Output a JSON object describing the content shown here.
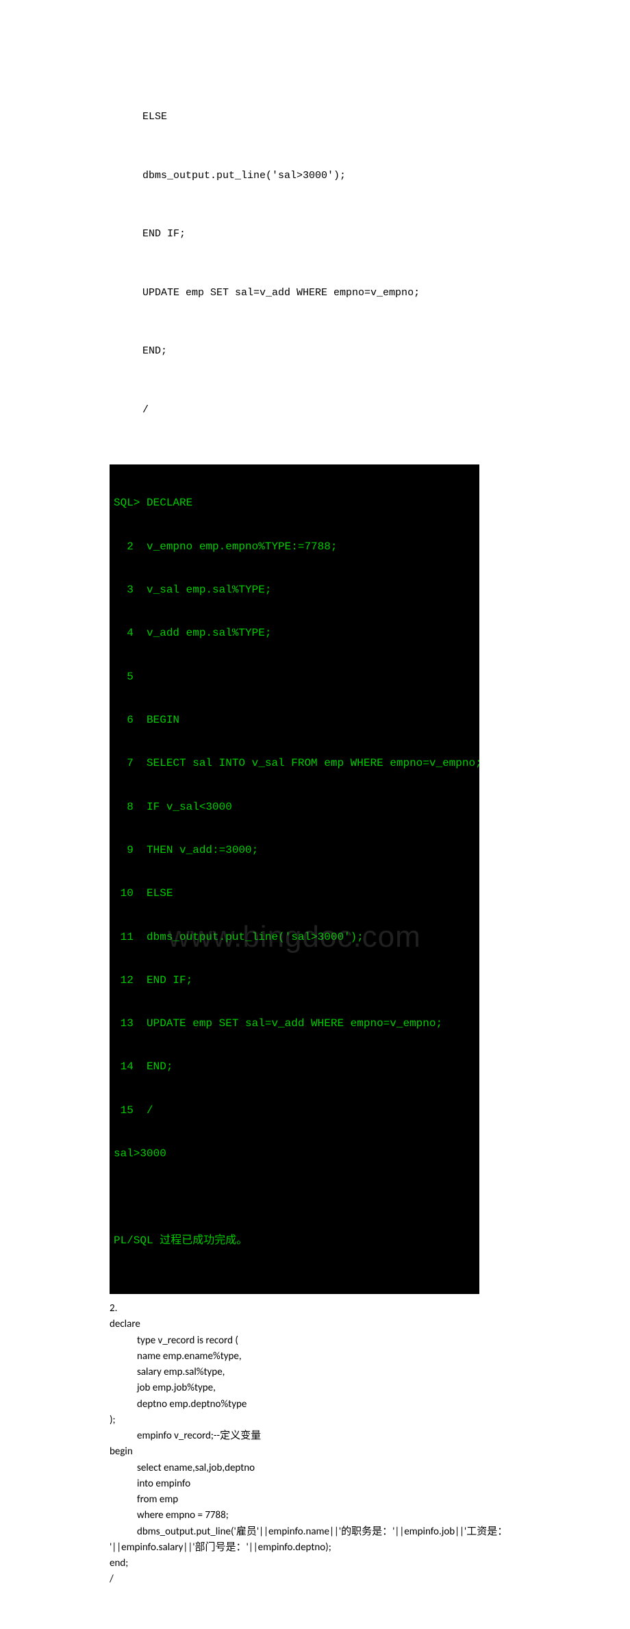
{
  "code1": {
    "l1": "ELSE",
    "l2": "dbms_output.put_line('sal>3000');",
    "l3": "END IF;",
    "l4": "UPDATE emp SET sal=v_add WHERE empno=v_empno;",
    "l5": "END;",
    "l6": "/"
  },
  "terminal": {
    "l1": "SQL> DECLARE",
    "l2": "  2  v_empno emp.empno%TYPE:=7788;",
    "l3": "  3  v_sal emp.sal%TYPE;",
    "l4": "  4  v_add emp.sal%TYPE;",
    "l5": "  5",
    "l6": "  6  BEGIN",
    "l7": "  7  SELECT sal INTO v_sal FROM emp WHERE empno=v_empno;",
    "l8": "  8  IF v_sal<3000",
    "l9": "  9  THEN v_add:=3000;",
    "l10": " 10  ELSE",
    "l11": " 11  dbms_output.put_line('sal>3000');",
    "l12": " 12  END IF;",
    "l13": " 13  UPDATE emp SET sal=v_add WHERE empno=v_empno;",
    "l14": " 14  END;",
    "l15": " 15  /",
    "l16": "sal>3000",
    "l17": " ",
    "l18": "PL/SQL 过程已成功完成。"
  },
  "watermark": "www.bingdoc.com",
  "section2": {
    "num": "2.",
    "l1": "declare",
    "l2": "type v_record is record (",
    "l3": "name emp.ename%type,",
    "l4": "salary emp.sal%type,",
    "l5": "job emp.job%type,",
    "l6": "deptno emp.deptno%type",
    "l7": ");",
    "l8": "empinfo v_record;--定义变量",
    "l9": "begin",
    "l10": "select ename,sal,job,deptno",
    "l11": "into empinfo",
    "l12": "from emp",
    "l13": "where empno = 7788;",
    "l14a": "dbms_output.put_line('雇员'||empinfo.name||'的职务是：'||empinfo.job||'工资是：",
    "l14b": "'||empinfo.salary||'部门号是：'||empinfo.deptno);",
    "l15": "end;",
    "l16": "/"
  }
}
